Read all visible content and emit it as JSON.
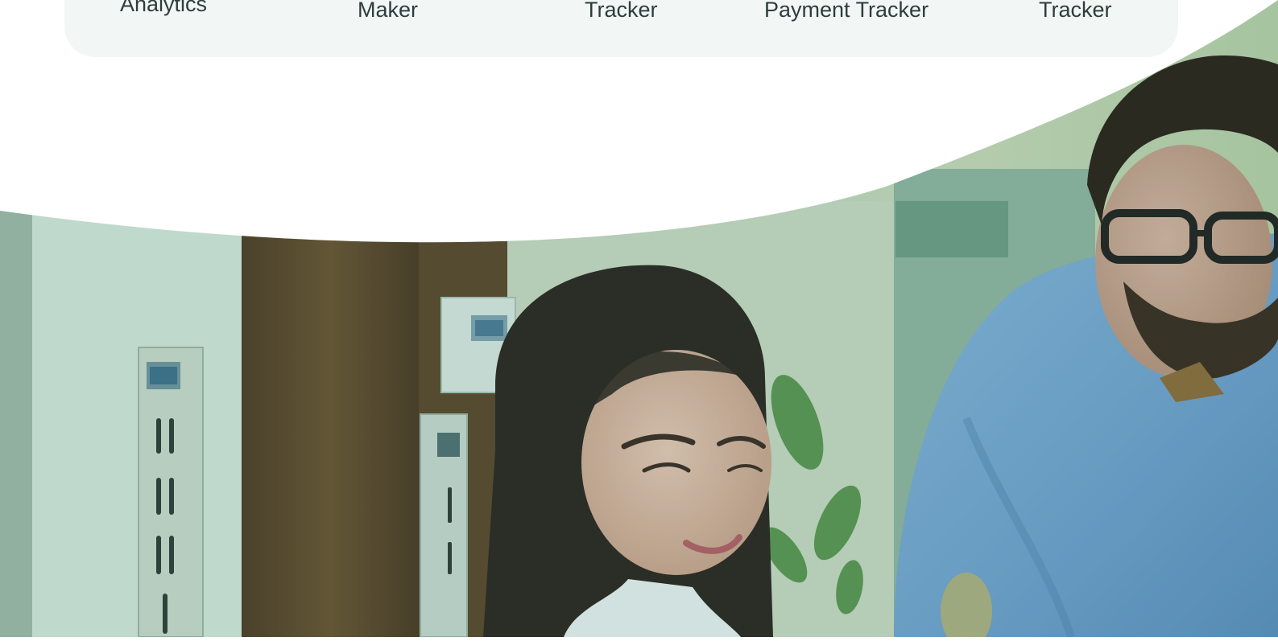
{
  "features": {
    "items": [
      {
        "label": "Analytics"
      },
      {
        "label": "Maker"
      },
      {
        "label": "Tracker"
      },
      {
        "label": "Payment Tracker"
      },
      {
        "label": "Tracker"
      }
    ]
  },
  "hero": {
    "image_alt": "Two people looking at a screen together in an office",
    "overlay_color": "#2f7a5a"
  }
}
